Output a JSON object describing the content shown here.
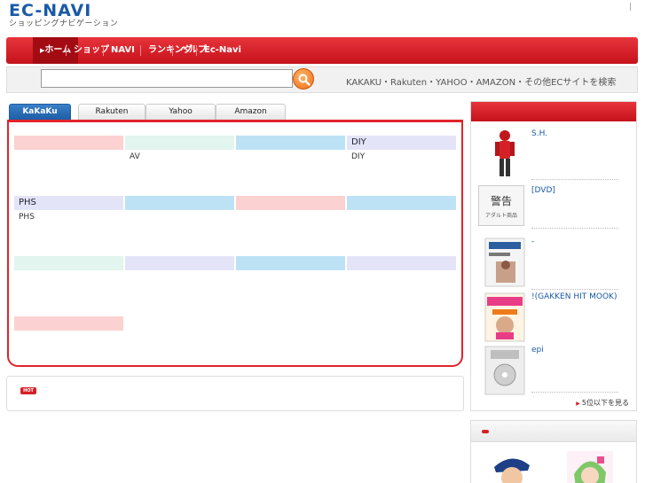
{
  "header": {
    "logo_main": "EC-NAVI",
    "logo_sub": "ショッピングナビゲーション",
    "top_links": [
      "",
      "",
      ""
    ]
  },
  "nav": {
    "items": [
      {
        "label": "ホーム",
        "active": true
      },
      {
        "label": "ショップ"
      },
      {
        "label": "NAVI"
      },
      {
        "label": "ランキング"
      },
      {
        "label": "ヘルプ"
      },
      {
        "label": "Ec-Navi"
      }
    ]
  },
  "search": {
    "placeholder": "",
    "description": "KAKAKU・Rakuten・YAHOO・AMAZON・その他ECサイトを検索"
  },
  "tabs": [
    "KaKaKu",
    "Rakuten",
    "Yahoo",
    "Amazon"
  ],
  "categories": [
    {
      "title": "",
      "color": "#fcd1d1",
      "links": [
        "",
        ""
      ]
    },
    {
      "title": "",
      "color": "#e2f5ee",
      "links": [
        "AV",
        ""
      ]
    },
    {
      "title": "",
      "color": "#bde2f6",
      "links": [
        "",
        ""
      ]
    },
    {
      "title": "DIY",
      "color": "#e4e4f8",
      "links": [
        "DIY",
        ""
      ]
    },
    {
      "title": "PHS",
      "color": "#e4e4f8",
      "links": [
        "PHS",
        ""
      ]
    },
    {
      "title": "",
      "color": "#bde2f6",
      "links": [
        "",
        ""
      ]
    },
    {
      "title": "",
      "color": "#fcd1d1",
      "links": [
        "",
        ""
      ]
    },
    {
      "title": "",
      "color": "#bde2f6",
      "links": [
        "",
        ""
      ]
    },
    {
      "title": "",
      "color": "#e2f5ee",
      "links": [
        "",
        ""
      ]
    },
    {
      "title": "",
      "color": "#e4e4f8",
      "links": [
        "",
        ""
      ]
    },
    {
      "title": "",
      "color": "#bde2f6",
      "links": [
        "",
        ""
      ]
    },
    {
      "title": "",
      "color": "#e4e4f8",
      "links": [
        "",
        ""
      ]
    },
    {
      "title": "",
      "color": "#fcd1d1",
      "links": [
        "",
        ""
      ]
    }
  ],
  "hot": {
    "badge": "HOT",
    "title": ""
  },
  "ranking": {
    "title": "",
    "items": [
      {
        "name": "S.H.",
        "extra": ""
      },
      {
        "name": "",
        "extra": "[DVD]",
        "warning": "警告",
        "warning_sub": "アダルト商品"
      },
      {
        "name": "-",
        "extra": ""
      },
      {
        "name": "!(GAKKEN HIT MOOK)",
        "extra": ""
      },
      {
        "name": "epi",
        "extra": ""
      }
    ],
    "more": "5位以下を見る"
  },
  "second": {
    "title": ""
  }
}
